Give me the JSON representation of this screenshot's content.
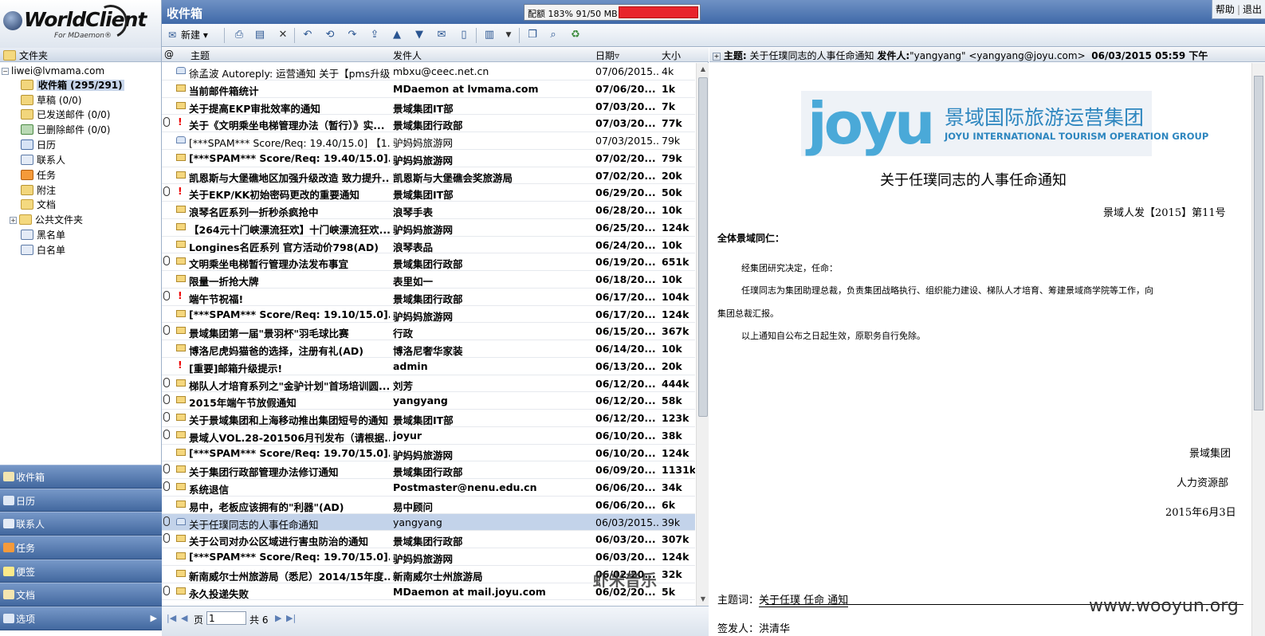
{
  "app": {
    "logo_text": "WorldClient",
    "logo_sub": "For MDaemon®"
  },
  "topbar": {
    "title": "收件箱",
    "quota_text": "配额 183% 91/50 MB",
    "help": "帮助",
    "logout": "退出"
  },
  "toolbar": {
    "new_label": "新建"
  },
  "folders": {
    "header": "文件夹",
    "account": "liwei@lvmama.com",
    "items": [
      {
        "label": "收件箱 (295/291)",
        "icon": "inbox-icon"
      },
      {
        "label": "草稿 (0/0)",
        "icon": "drafts-icon"
      },
      {
        "label": "已发送邮件 (0/0)",
        "icon": "sent-icon"
      },
      {
        "label": "已删除邮件 (0/0)",
        "icon": "deleted-icon"
      },
      {
        "label": "日历",
        "icon": "calendar-icon"
      },
      {
        "label": "联系人",
        "icon": "contacts-icon"
      },
      {
        "label": "任务",
        "icon": "tasks-icon"
      },
      {
        "label": "附注",
        "icon": "notes-icon"
      },
      {
        "label": "文档",
        "icon": "documents-icon"
      },
      {
        "label": "公共文件夹",
        "icon": "public-folder-icon"
      },
      {
        "label": "黑名单",
        "icon": "blacklist-icon"
      },
      {
        "label": "白名单",
        "icon": "whitelist-icon"
      }
    ]
  },
  "nav": {
    "items": [
      "收件箱",
      "日历",
      "联系人",
      "任务",
      "便签",
      "文档",
      "选项"
    ]
  },
  "list": {
    "headers": {
      "subject": "主题",
      "from": "发件人",
      "date": "日期",
      "size": "大小"
    },
    "rows": [
      {
        "subject": "徐孟波 Autoreply: 运营通知 关于【pms升级...",
        "from": "mbxu@ceec.net.cn",
        "date": "07/06/2015...",
        "size": "4k",
        "att": false,
        "imp": false,
        "read": true
      },
      {
        "subject": "当前邮件箱统计",
        "from": "MDaemon at lvmama.com",
        "date": "07/06/20...",
        "size": "1k",
        "att": false,
        "imp": false,
        "read": false
      },
      {
        "subject": "关于提高EKP审批效率的通知",
        "from": "景域集团IT部",
        "date": "07/03/20...",
        "size": "7k",
        "att": false,
        "imp": false,
        "read": false
      },
      {
        "subject": "关于《文明乘坐电梯管理办法（暂行）》实...",
        "from": "景域集团行政部",
        "date": "07/03/20...",
        "size": "77k",
        "att": true,
        "imp": true,
        "read": false
      },
      {
        "subject": "[***SPAM*** Score/Req: 19.40/15.0] 【1...",
        "from": "驴妈妈旅游网",
        "date": "07/03/2015...",
        "size": "79k",
        "att": false,
        "imp": false,
        "read": true
      },
      {
        "subject": "[***SPAM*** Score/Req: 19.40/15.0]...",
        "from": "驴妈妈旅游网",
        "date": "07/02/20...",
        "size": "79k",
        "att": false,
        "imp": false,
        "read": false
      },
      {
        "subject": "凯恩斯与大堡礁地区加强升级改造 致力提升...",
        "from": "凯恩斯与大堡礁会奖旅游局",
        "date": "07/02/20...",
        "size": "20k",
        "att": false,
        "imp": false,
        "read": false
      },
      {
        "subject": "关于EKP/KK初始密码更改的重要通知",
        "from": "景域集团IT部",
        "date": "06/29/20...",
        "size": "50k",
        "att": true,
        "imp": true,
        "read": false
      },
      {
        "subject": "浪琴名匠系列一折秒杀疯抢中",
        "from": "浪琴手表",
        "date": "06/28/20...",
        "size": "10k",
        "att": false,
        "imp": false,
        "read": false
      },
      {
        "subject": "【264元十门峡漂流狂欢】十门峡漂流狂欢...",
        "from": "驴妈妈旅游网",
        "date": "06/25/20...",
        "size": "124k",
        "att": false,
        "imp": false,
        "read": false
      },
      {
        "subject": "Longines名匠系列 官方活动价798(AD)",
        "from": "浪琴表品",
        "date": "06/24/20...",
        "size": "10k",
        "att": false,
        "imp": false,
        "read": false
      },
      {
        "subject": "文明乘坐电梯暂行管理办法发布事宜",
        "from": "景域集团行政部",
        "date": "06/19/20...",
        "size": "651k",
        "att": true,
        "imp": false,
        "read": false
      },
      {
        "subject": "限量一折抢大牌",
        "from": "表里如一",
        "date": "06/18/20...",
        "size": "10k",
        "att": false,
        "imp": false,
        "read": false
      },
      {
        "subject": "端午节祝福!",
        "from": "景域集团行政部",
        "date": "06/17/20...",
        "size": "104k",
        "att": true,
        "imp": true,
        "read": false
      },
      {
        "subject": "[***SPAM*** Score/Req: 19.10/15.0]...",
        "from": "驴妈妈旅游网",
        "date": "06/17/20...",
        "size": "124k",
        "att": false,
        "imp": false,
        "read": false
      },
      {
        "subject": "景域集团第一届\"景羽杯\"羽毛球比赛",
        "from": "行政",
        "date": "06/15/20...",
        "size": "367k",
        "att": true,
        "imp": false,
        "read": false
      },
      {
        "subject": "博洛尼虎妈猫爸的选择，注册有礼(AD)",
        "from": "博洛尼奢华家装",
        "date": "06/14/20...",
        "size": "10k",
        "att": false,
        "imp": false,
        "read": false
      },
      {
        "subject": "[重要]邮箱升级提示!",
        "from": "admin",
        "date": "06/13/20...",
        "size": "20k",
        "att": false,
        "imp": true,
        "read": false
      },
      {
        "subject": "梯队人才培育系列之\"金驴计划\"首场培训圆...",
        "from": "刘芳",
        "date": "06/12/20...",
        "size": "444k",
        "att": true,
        "imp": false,
        "read": false
      },
      {
        "subject": "2015年端午节放假通知",
        "from": "yangyang",
        "date": "06/12/20...",
        "size": "58k",
        "att": true,
        "imp": false,
        "read": false
      },
      {
        "subject": "关于景域集团和上海移动推出集团短号的通知",
        "from": "景域集团IT部",
        "date": "06/12/20...",
        "size": "123k",
        "att": true,
        "imp": false,
        "read": false
      },
      {
        "subject": "景域人VOL.28-201506月刊发布（请根据...",
        "from": "joyur",
        "date": "06/10/20...",
        "size": "38k",
        "att": true,
        "imp": false,
        "read": false
      },
      {
        "subject": "[***SPAM*** Score/Req: 19.70/15.0]...",
        "from": "驴妈妈旅游网",
        "date": "06/10/20...",
        "size": "124k",
        "att": false,
        "imp": false,
        "read": false
      },
      {
        "subject": "关于集团行政部管理办法修订通知",
        "from": "景域集团行政部",
        "date": "06/09/20...",
        "size": "1131k",
        "att": true,
        "imp": false,
        "read": false
      },
      {
        "subject": "系统退信",
        "from": "Postmaster@nenu.edu.cn",
        "date": "06/06/20...",
        "size": "34k",
        "att": true,
        "imp": false,
        "read": false
      },
      {
        "subject": "易中，老板应该拥有的\"利器\"(AD)",
        "from": "易中顾问",
        "date": "06/06/20...",
        "size": "6k",
        "att": false,
        "imp": false,
        "read": false
      },
      {
        "subject": "关于任璞同志的人事任命通知",
        "from": "yangyang",
        "date": "06/03/2015...",
        "size": "39k",
        "att": true,
        "imp": false,
        "read": true,
        "selected": true
      },
      {
        "subject": "关于公司对办公区域进行害虫防治的通知",
        "from": "景域集团行政部",
        "date": "06/03/20...",
        "size": "307k",
        "att": true,
        "imp": false,
        "read": false
      },
      {
        "subject": "[***SPAM*** Score/Req: 19.70/15.0]...",
        "from": "驴妈妈旅游网",
        "date": "06/03/20...",
        "size": "124k",
        "att": false,
        "imp": false,
        "read": false
      },
      {
        "subject": "新南威尔士州旅游局（悉尼）2014/15年度...",
        "from": "新南威尔士州旅游局",
        "date": "06/02/20...",
        "size": "32k",
        "att": false,
        "imp": false,
        "read": false
      },
      {
        "subject": "永久投递失败",
        "from": "MDaemon at mail.joyu.com",
        "date": "06/02/20...",
        "size": "5k",
        "att": true,
        "imp": false,
        "read": false
      }
    ]
  },
  "pager": {
    "page_label": "页",
    "page_value": "1",
    "total_label": "共",
    "total": "6"
  },
  "preview": {
    "subject_label": "主题:",
    "subject": "关于任璞同志的人事任命通知",
    "from_label": "发件人:",
    "from": "\"yangyang\" <yangyang@joyu.com>",
    "date": "06/03/2015 05:59 下午",
    "logo_text": "joyu",
    "logo_cn": "景域国际旅游运营集团",
    "logo_en": "JOYU INTERNATIONAL TOURISM OPERATION GROUP",
    "doc_title": "关于任璞同志的人事任命通知",
    "doc_number": "景域人发【2015】第11号",
    "salutation": "全体景域同仁：",
    "para1": "经集团研究决定，任命：",
    "para2a": "任璞同志为集团助理总裁，负责集团战略执行、组织能力建设、梯队人才培育、筹建景域商学院等工作，向",
    "para2b": "集团总裁汇报。",
    "para3": "以上通知自公布之日起生效，原职务自行免除。",
    "sign_org": "景域集团",
    "sign_dept": "人力资源部",
    "sign_date": "2015年6月3日",
    "keywords_label": "主题词：",
    "keywords": "关于任璞 任命 通知",
    "issuer_label": "签发人：",
    "issuer": "洪清华"
  },
  "watermarks": {
    "left": "虾米音乐",
    "right": "www.wooyun.org"
  }
}
